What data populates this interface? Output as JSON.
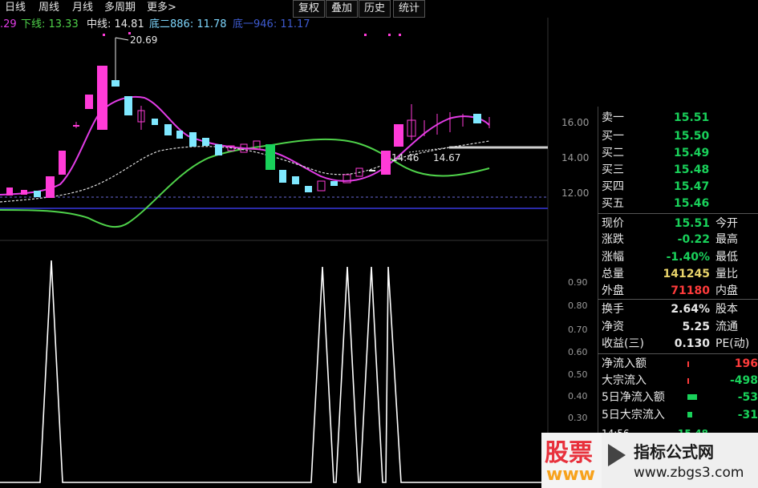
{
  "toolbar": {
    "tabs": [
      "日线",
      "周线",
      "月线",
      "多周期",
      "更多>"
    ],
    "buttons": [
      "复权",
      "叠加",
      "历史",
      "统计"
    ]
  },
  "indicator_legend": {
    "prefix": ".29",
    "lower": "下线: 13.33",
    "middle": "中线: 14.81",
    "bottom2": "底二886: 11.78",
    "bottom1": "底一946: 11.17"
  },
  "chart_annotations": {
    "high": "20.69",
    "left_price": "14.46",
    "right_price": "14.67"
  },
  "price_axis": [
    "16.00",
    "14.00",
    "12.00"
  ],
  "indicator_axis": [
    "0.90",
    "0.80",
    "0.70",
    "0.60",
    "0.50",
    "0.40",
    "0.30"
  ],
  "order_book": [
    {
      "label": "卖一",
      "value": "15.51",
      "color": "#19d15a"
    },
    {
      "label": "买一",
      "value": "15.50",
      "color": "#19d15a"
    },
    {
      "label": "买二",
      "value": "15.49",
      "color": "#19d15a"
    },
    {
      "label": "买三",
      "value": "15.48",
      "color": "#19d15a"
    },
    {
      "label": "买四",
      "value": "15.47",
      "color": "#19d15a"
    },
    {
      "label": "买五",
      "value": "15.46",
      "color": "#19d15a"
    }
  ],
  "quote": [
    {
      "label": "现价",
      "value": "15.51",
      "color": "#19d15a",
      "label2": "今开"
    },
    {
      "label": "涨跌",
      "value": "-0.22",
      "color": "#19d15a",
      "label2": "最高"
    },
    {
      "label": "涨幅",
      "value": "-1.40%",
      "color": "#19d15a",
      "label2": "最低"
    },
    {
      "label": "总量",
      "value": "141245",
      "color": "#e8d36a",
      "label2": "量比"
    },
    {
      "label": "外盘",
      "value": "71180",
      "color": "#ff3b3b",
      "label2": "内盘"
    }
  ],
  "fundamentals": [
    {
      "label": "换手",
      "value": "2.64%",
      "label2": "股本"
    },
    {
      "label": "净资",
      "value": "5.25",
      "label2": "流通"
    },
    {
      "label": "收益(三)",
      "value": "0.130",
      "label2": "PE(动)"
    }
  ],
  "capital_flow": [
    {
      "label": "净流入额",
      "value": "196",
      "color": "#ff3b3b"
    },
    {
      "label": "大宗流入",
      "value": "-498",
      "color": "#19d15a"
    },
    {
      "label": "5日净流入额",
      "value": "-53",
      "color": "#19d15a"
    },
    {
      "label": "5日大宗流入",
      "value": "-31",
      "color": "#19d15a"
    }
  ],
  "bottom_row": {
    "time": "14:56",
    "value": "15.48"
  },
  "watermark": {
    "left_top": "股票",
    "left_bottom": "www",
    "right_title": "指标公式网",
    "right_url": "www.zbgs3.com"
  },
  "colors": {
    "up": "#ff3bd8",
    "down": "#7fe8ff",
    "green_candle": "#19d15a",
    "ma_magenta": "#e23ce6",
    "ma_green": "#4fd24a",
    "blue_line": "#2a2aa8"
  }
}
